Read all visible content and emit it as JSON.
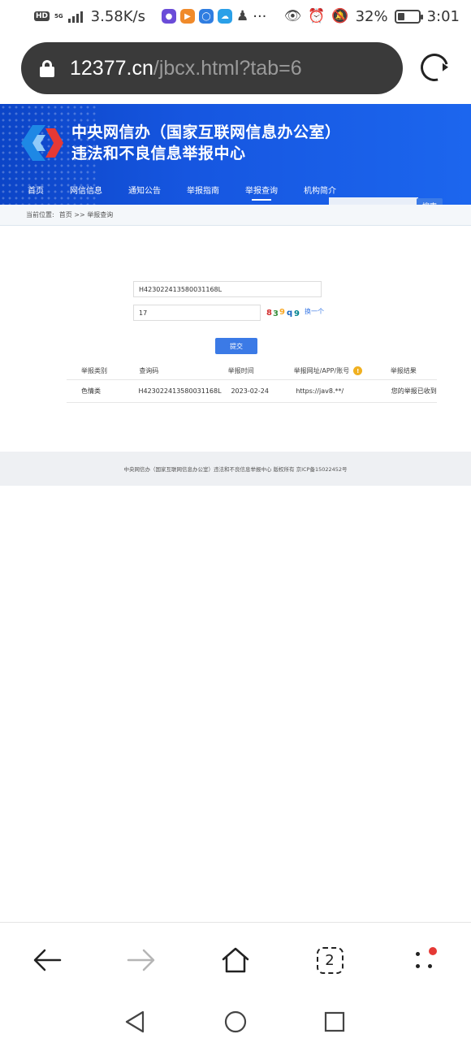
{
  "status_bar": {
    "hd": "HD",
    "network": "5G",
    "speed": "3.58K/s",
    "ellipsis": "···",
    "battery_percent_label": "32%",
    "battery_level": 0.32,
    "time": "3:01"
  },
  "browser": {
    "url_host": "12377.cn",
    "url_path": "/jbcx.html?tab=6",
    "tab_count": "2"
  },
  "site": {
    "title_line1": "中央网信办（国家互联网信息办公室）",
    "title_line2": "违法和不良信息举报中心",
    "nav": [
      "首页",
      "网信信息",
      "通知公告",
      "举报指南",
      "举报查询",
      "机构简介"
    ],
    "search_button": "搜索",
    "breadcrumb_label": "当前位置:",
    "breadcrumb_path": "首页 >> 举报查询"
  },
  "query": {
    "report_code": "H42302241358003116­8L",
    "captcha_value": "17",
    "captcha_text": "8 3 9 q 9",
    "refresh_label": "换一个",
    "submit_label": "提交"
  },
  "table": {
    "headers": [
      "举报类别",
      "查询码",
      "举报时间",
      "举报网址/APP/账号",
      "举报结果"
    ],
    "rows": [
      [
        "色情类",
        "H42302241358003116­8L",
        "2023-02-24",
        "https://jav8.**/",
        "您的举报已收到"
      ]
    ]
  },
  "footer": {
    "text": "中央网信办（国家互联网信息办公室）违法和不良信息举报中心 版权所有 京ICP备15022452号"
  },
  "colors": {
    "header_blue": "#1656e0",
    "accent_blue": "#3b7ae6",
    "info_yellow": "#f0b020",
    "notification_red": "#e53935"
  }
}
